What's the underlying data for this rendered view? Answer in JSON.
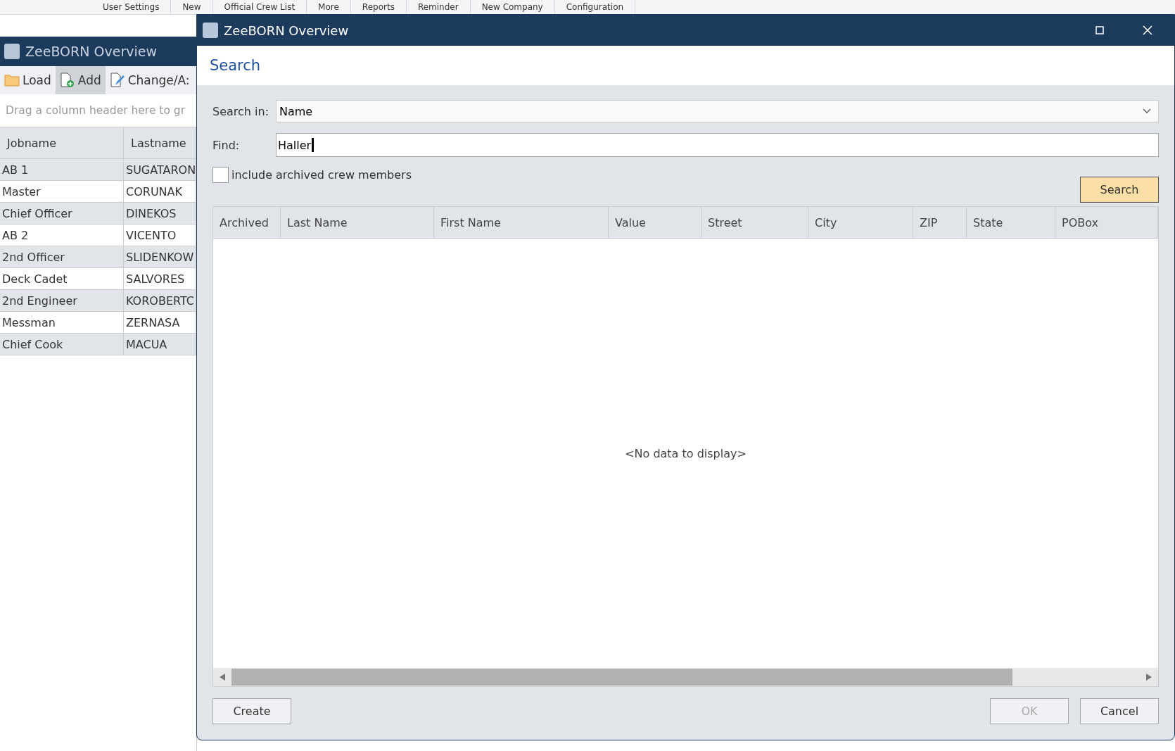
{
  "ribbon": {
    "items": [
      "User Settings",
      "New",
      "Official Crew List",
      "More",
      "Reports",
      "Reminder",
      "New Company",
      "Configuration"
    ]
  },
  "background_window": {
    "title": "ZeeBORN Overview",
    "toolbar": [
      {
        "label": "Load",
        "selected": false
      },
      {
        "label": "Add",
        "selected": true
      },
      {
        "label": "Change/A:",
        "selected": false
      }
    ],
    "group_panel": "Drag a column header here to gr",
    "columns": [
      "Jobname",
      "Lastname"
    ],
    "rows": [
      [
        "AB 1",
        "SUGATARON"
      ],
      [
        "Master",
        "CORUNAK"
      ],
      [
        "Chief Officer",
        "DINEKOS"
      ],
      [
        "AB 2",
        "VICENTO"
      ],
      [
        "2nd Officer",
        "SLIDENKOW"
      ],
      [
        "Deck Cadet",
        "SALVORES"
      ],
      [
        "2nd Engineer",
        "KOROBERTC"
      ],
      [
        "Messman",
        "ZERNASA"
      ],
      [
        "Chief Cook",
        "MACUA"
      ]
    ]
  },
  "dialog": {
    "title": "ZeeBORN Overview",
    "heading": "Search",
    "search_in": {
      "label": "Search in:",
      "value": "Name"
    },
    "find": {
      "label": "Find:",
      "value": "Haller"
    },
    "include_archived": {
      "label": "include archived crew members",
      "checked": false
    },
    "search_button": {
      "label": "Search",
      "default": true
    },
    "table": {
      "columns": [
        "Archived",
        "Last Name",
        "First Name",
        "Value",
        "Street",
        "City",
        "ZIP",
        "State",
        "POBox"
      ],
      "empty_text": "<No data to display>"
    },
    "buttons": [
      {
        "label": "Create",
        "disabled": false
      },
      {
        "label": "OK",
        "disabled": true
      },
      {
        "label": "Cancel",
        "disabled": false
      }
    ]
  }
}
